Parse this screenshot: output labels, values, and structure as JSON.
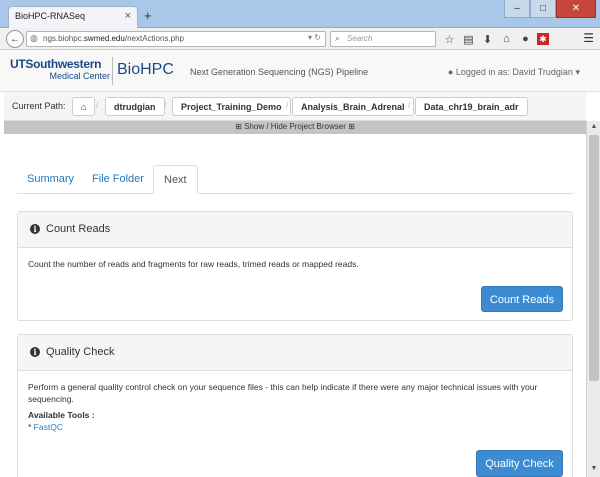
{
  "browser": {
    "tab_title": "BioHPC-RNASeq",
    "url_prefix": "ngs.biohpc.",
    "url_host": "swmed.edu",
    "url_path": "/nextActions.php",
    "search_placeholder": "Search",
    "win_minimize": "–",
    "win_maximize": "□",
    "win_close": "✕"
  },
  "header": {
    "logo_top": "UTSouthwestern",
    "logo_bottom": "Medical Center",
    "brand": "BioHPC",
    "pipeline": "Next Generation Sequencing (NGS) Pipeline",
    "user_text": "Logged in as: David Trudgian"
  },
  "breadcrumb": {
    "label": "Current Path:",
    "items": [
      "dtrudgian",
      "Project_Training_Demo",
      "Analysis_Brain_Adrenal",
      "Data_chr19_brain_adr"
    ]
  },
  "toggle_label": "Show / Hide Project Browser",
  "tabs": [
    {
      "label": "Summary"
    },
    {
      "label": "File Folder"
    },
    {
      "label": "Next"
    }
  ],
  "panels": {
    "count_reads": {
      "title": "Count Reads",
      "body": "Count the number of reads and fragments for raw reads, trimed reads or mapped reads.",
      "button": "Count Reads"
    },
    "quality_check": {
      "title": "Quality Check",
      "body": "Perform a general quality control check on your sequence files - this can help indicate if there were any major technical issues with your sequencing.",
      "tools_title": "Available Tools :",
      "tools": [
        "FastQC"
      ],
      "button": "Quality Check"
    }
  }
}
